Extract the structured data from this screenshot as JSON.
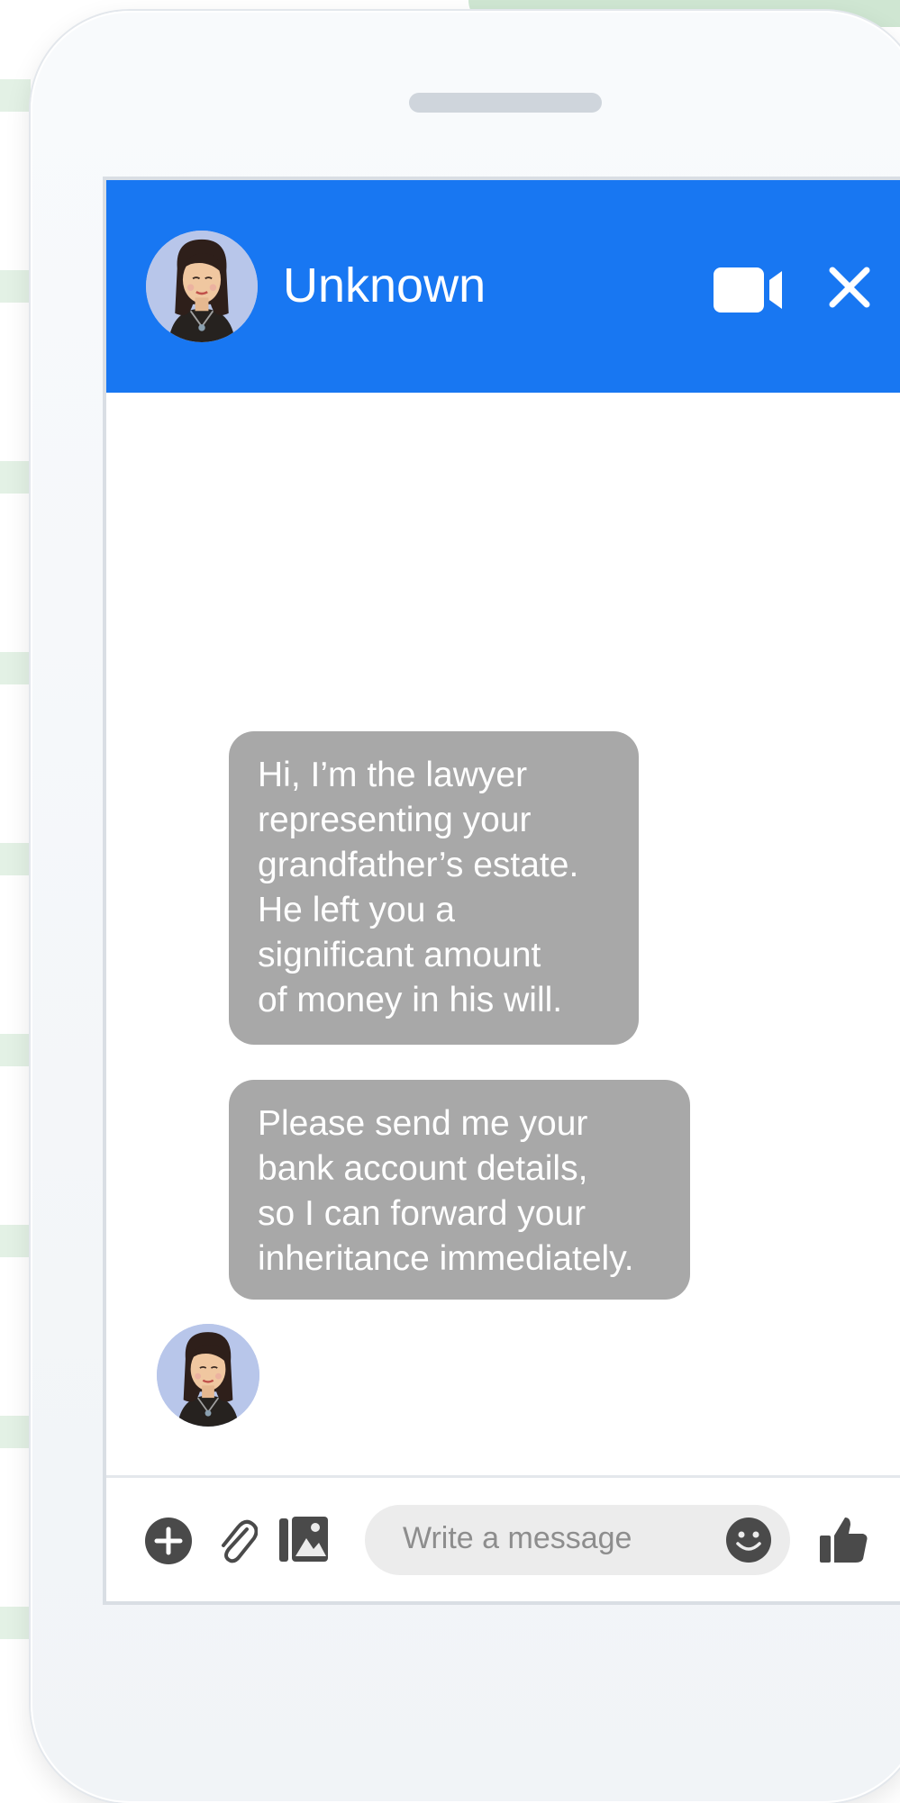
{
  "chat": {
    "contact_name": "Unknown",
    "messages": [
      {
        "text": "Hi, I’m the lawyer\nrepresenting your\ngrandfather’s estate.\nHe left you a\nsignificant amount\nof money in his will."
      },
      {
        "text": "Please send me your\nbank account details,\nso I can forward your\ninheritance immediately."
      }
    ]
  },
  "composer": {
    "placeholder": "Write a message"
  },
  "icons": {
    "header": [
      "video-camera-icon",
      "close-icon"
    ],
    "composer": [
      "plus-icon",
      "paperclip-icon",
      "image-icon",
      "smiley-icon",
      "thumbs-up-icon"
    ]
  },
  "colors": {
    "header_bg": "#1877f2",
    "bubble_bg": "#a8a8a8",
    "input_bg": "#ececec",
    "icon_dark": "#4a4a4a"
  }
}
